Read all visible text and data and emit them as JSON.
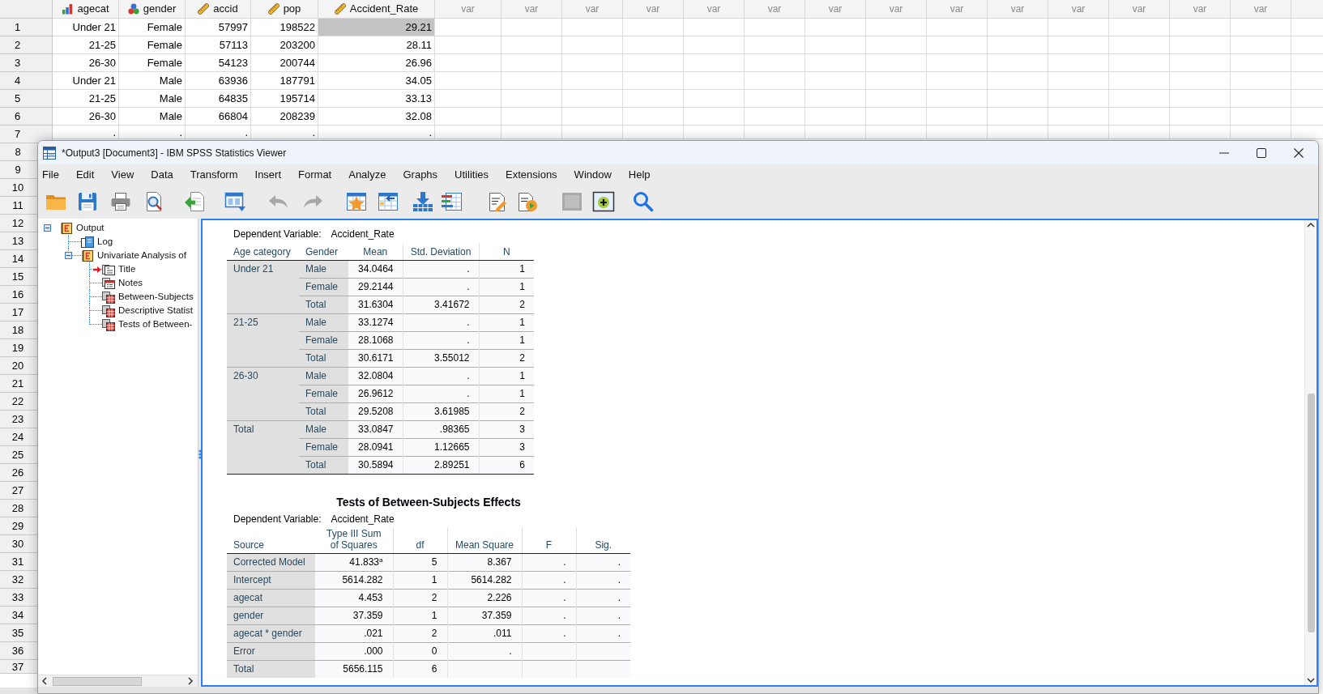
{
  "data_editor": {
    "columns": [
      {
        "label": "agecat",
        "kind": "ordinal"
      },
      {
        "label": "gender",
        "kind": "nominal"
      },
      {
        "label": "accid",
        "kind": "scale"
      },
      {
        "label": "pop",
        "kind": "scale"
      },
      {
        "label": "Accident_Rate",
        "kind": "scale"
      },
      {
        "label": "var",
        "kind": "placeholder"
      },
      {
        "label": "var",
        "kind": "placeholder"
      },
      {
        "label": "var",
        "kind": "placeholder"
      },
      {
        "label": "var",
        "kind": "placeholder"
      },
      {
        "label": "var",
        "kind": "placeholder"
      },
      {
        "label": "var",
        "kind": "placeholder"
      },
      {
        "label": "var",
        "kind": "placeholder"
      },
      {
        "label": "var",
        "kind": "placeholder"
      },
      {
        "label": "var",
        "kind": "placeholder"
      },
      {
        "label": "var",
        "kind": "placeholder"
      },
      {
        "label": "var",
        "kind": "placeholder"
      },
      {
        "label": "var",
        "kind": "placeholder"
      },
      {
        "label": "var",
        "kind": "placeholder"
      },
      {
        "label": "var",
        "kind": "placeholder"
      }
    ],
    "row_numbers": [
      "1",
      "2",
      "3",
      "4",
      "5",
      "6",
      "7",
      "8",
      "9",
      "10",
      "11",
      "12",
      "13",
      "14",
      "15",
      "16",
      "17",
      "18",
      "19",
      "20",
      "21",
      "22",
      "23",
      "24",
      "25",
      "26",
      "27",
      "28",
      "29",
      "30",
      "31",
      "32",
      "33",
      "34",
      "35",
      "36",
      "37"
    ],
    "rows": [
      {
        "cells": [
          {
            "value": "Under 21",
            "selected": false
          },
          {
            "value": "Female",
            "selected": false
          },
          {
            "value": "57997",
            "selected": false
          },
          {
            "value": "198522",
            "selected": false
          },
          {
            "value": "29.21",
            "selected": true
          }
        ]
      },
      {
        "cells": [
          {
            "value": "21-25",
            "selected": false
          },
          {
            "value": "Female",
            "selected": false
          },
          {
            "value": "57113",
            "selected": false
          },
          {
            "value": "203200",
            "selected": false
          },
          {
            "value": "28.11",
            "selected": false
          }
        ]
      },
      {
        "cells": [
          {
            "value": "26-30",
            "selected": false
          },
          {
            "value": "Female",
            "selected": false
          },
          {
            "value": "54123",
            "selected": false
          },
          {
            "value": "200744",
            "selected": false
          },
          {
            "value": "26.96",
            "selected": false
          }
        ]
      },
      {
        "cells": [
          {
            "value": "Under 21",
            "selected": false
          },
          {
            "value": "Male",
            "selected": false
          },
          {
            "value": "63936",
            "selected": false
          },
          {
            "value": "187791",
            "selected": false
          },
          {
            "value": "34.05",
            "selected": false
          }
        ]
      },
      {
        "cells": [
          {
            "value": "21-25",
            "selected": false
          },
          {
            "value": "Male",
            "selected": false
          },
          {
            "value": "64835",
            "selected": false
          },
          {
            "value": "195714",
            "selected": false
          },
          {
            "value": "33.13",
            "selected": false
          }
        ]
      },
      {
        "cells": [
          {
            "value": "26-30",
            "selected": false
          },
          {
            "value": "Male",
            "selected": false
          },
          {
            "value": "66804",
            "selected": false
          },
          {
            "value": "208239",
            "selected": false
          },
          {
            "value": "32.08",
            "selected": false
          }
        ]
      },
      {
        "cells": [
          {
            "value": ".",
            "selected": false
          },
          {
            "value": ".",
            "selected": false
          },
          {
            "value": ".",
            "selected": false
          },
          {
            "value": ".",
            "selected": false
          },
          {
            "value": ".",
            "selected": false
          }
        ]
      }
    ]
  },
  "viewer": {
    "title": "*Output3 [Document3] - IBM SPSS Statistics Viewer",
    "menu": [
      "File",
      "Edit",
      "View",
      "Data",
      "Transform",
      "Insert",
      "Format",
      "Analyze",
      "Graphs",
      "Utilities",
      "Extensions",
      "Window",
      "Help"
    ],
    "toolbar": [
      {
        "disabled": false
      },
      {
        "disabled": false
      },
      {
        "disabled": false
      },
      {
        "disabled": false
      },
      {
        "disabled": false
      },
      {
        "disabled": false
      },
      {
        "disabled": true
      },
      {
        "disabled": true
      },
      {
        "disabled": false
      },
      {
        "disabled": false
      },
      {
        "disabled": false
      },
      {
        "disabled": false
      },
      {
        "disabled": false
      },
      {
        "disabled": false
      },
      {
        "disabled": true
      },
      {
        "disabled": false
      },
      {
        "disabled": false
      }
    ],
    "outline": [
      {
        "label": "Output",
        "kind": "heading",
        "expanded": true,
        "selected": false,
        "children": [
          {
            "label": "Log",
            "kind": "log",
            "selected": false
          },
          {
            "label": "Univariate Analysis of",
            "kind": "heading",
            "expanded": true,
            "selected": false,
            "children": [
              {
                "label": "Title",
                "kind": "title",
                "selected": true
              },
              {
                "label": "Notes",
                "kind": "notes",
                "selected": false
              },
              {
                "label": "Between-Subjects",
                "kind": "table",
                "selected": false
              },
              {
                "label": "Descriptive Statist",
                "kind": "table",
                "selected": false
              },
              {
                "label": "Tests of Between-",
                "kind": "table",
                "selected": false
              }
            ]
          }
        ]
      }
    ],
    "output": {
      "means_table": {
        "dependent_variable_label": "Dependent Variable:",
        "dependent_variable": "Accident_Rate",
        "columns": [
          "Age category",
          "Gender",
          "Mean",
          "Std. Deviation",
          "N"
        ],
        "groups": [
          {
            "label": "Under 21",
            "rows": [
              [
                "Male",
                "34.0464",
                ".",
                "1"
              ],
              [
                "Female",
                "29.2144",
                ".",
                "1"
              ],
              [
                "Total",
                "31.6304",
                "3.41672",
                "2"
              ]
            ]
          },
          {
            "label": "21-25",
            "rows": [
              [
                "Male",
                "33.1274",
                ".",
                "1"
              ],
              [
                "Female",
                "28.1068",
                ".",
                "1"
              ],
              [
                "Total",
                "30.6171",
                "3.55012",
                "2"
              ]
            ]
          },
          {
            "label": "26-30",
            "rows": [
              [
                "Male",
                "32.0804",
                ".",
                "1"
              ],
              [
                "Female",
                "26.9612",
                ".",
                "1"
              ],
              [
                "Total",
                "29.5208",
                "3.61985",
                "2"
              ]
            ]
          },
          {
            "label": "Total",
            "rows": [
              [
                "Male",
                "33.0847",
                ".98365",
                "3"
              ],
              [
                "Female",
                "28.0941",
                "1.12665",
                "3"
              ],
              [
                "Total",
                "30.5894",
                "2.89251",
                "6"
              ]
            ]
          }
        ]
      },
      "effects_table": {
        "title": "Tests of Between-Subjects Effects",
        "dependent_variable_label": "Dependent Variable:",
        "dependent_variable": "Accident_Rate",
        "columns": [
          "Source",
          "Type III Sum of Squares",
          "df",
          "Mean Square",
          "F",
          "Sig."
        ],
        "rows": [
          [
            "Corrected Model",
            "41.833$^{a}$",
            "5",
            "8.367",
            ".",
            "."
          ],
          [
            "Intercept",
            "5614.282",
            "1",
            "5614.282",
            ".",
            "."
          ],
          [
            "agecat",
            "4.453",
            "2",
            "2.226",
            ".",
            "."
          ],
          [
            "gender",
            "37.359",
            "1",
            "37.359",
            ".",
            "."
          ],
          [
            "agecat * gender",
            ".021",
            "2",
            ".011",
            ".",
            "."
          ],
          [
            "Error",
            ".000",
            "0",
            "."
          ],
          [
            "Total",
            "5656.115",
            "6"
          ]
        ]
      }
    }
  }
}
